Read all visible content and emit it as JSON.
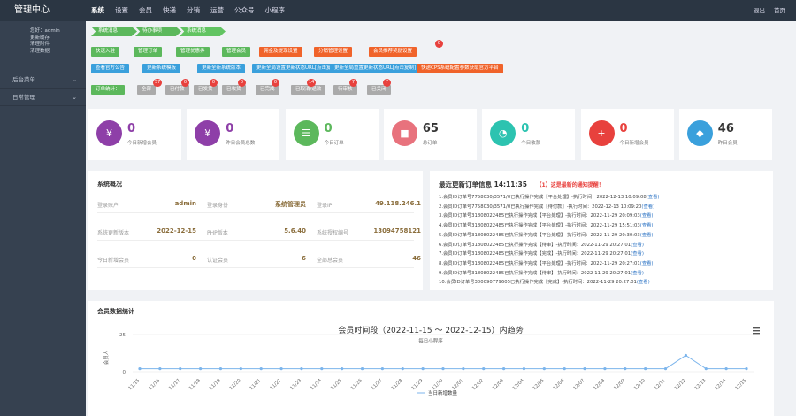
{
  "app": {
    "title": "管理中心"
  },
  "topnav": [
    "系统",
    "设置",
    "会员",
    "快递",
    "分销",
    "运营",
    "公众号",
    "小程序"
  ],
  "topright": [
    "退出",
    "首页"
  ],
  "user": {
    "greeting": "您好：admin",
    "links": [
      "更新缓存",
      "清理附件",
      "清理数据"
    ]
  },
  "sidebar": [
    {
      "label": "后台菜单"
    },
    {
      "label": "日常管理"
    }
  ],
  "toolbar": {
    "steps": [
      "系统消息",
      "待办事项",
      "系统消息"
    ],
    "row1": [
      {
        "label": "快速入驻",
        "color": "g"
      },
      {
        "label": "管理订单",
        "color": "g"
      },
      {
        "label": "管理优惠券",
        "color": "g"
      },
      {
        "label": "管理会员",
        "color": "g"
      },
      {
        "label": "佣金及提现设置",
        "color": "o"
      },
      {
        "label": "分销管理设置",
        "color": "o"
      },
      {
        "label": "会员推荐奖励设置",
        "color": "o",
        "badge": "0"
      }
    ],
    "row2": [
      {
        "label": "查看官方公告",
        "color": "b"
      },
      {
        "label": "更新系统模板",
        "color": "b"
      },
      {
        "label": "更新全新系统版本",
        "color": "b"
      },
      {
        "label": "更新全局设置更新状态URL[点击复制]",
        "color": "b"
      },
      {
        "label": "更新全局重置更新状态URL[点击复制]",
        "color": "b"
      },
      {
        "label": "快递CPS系统配置参数获取官方平台",
        "color": "o"
      }
    ],
    "orders_label": "订单统计：",
    "row3": [
      {
        "label": "全部",
        "badge": "57"
      },
      {
        "label": "已付款",
        "badge": "0"
      },
      {
        "label": "已发货",
        "badge": "0"
      },
      {
        "label": "已收货",
        "badge": "0"
      },
      {
        "label": "已完成",
        "badge": "0"
      },
      {
        "label": "已取消/退款",
        "badge": "14"
      },
      {
        "label": "待审核",
        "badge": "7"
      },
      {
        "label": "已关闭",
        "badge": "7"
      }
    ]
  },
  "stats": [
    {
      "value": "0",
      "label": "今日新增会员",
      "color": "#8e3fa8",
      "icon": "¥"
    },
    {
      "value": "0",
      "label": "昨日会员总数",
      "color": "#8e3fa8",
      "icon": "¥"
    },
    {
      "value": "0",
      "label": "今日订单",
      "color": "#5cb85c",
      "icon": "☰"
    },
    {
      "value": "65",
      "label": "总订单",
      "color": "#e8727d",
      "icon": "■"
    },
    {
      "value": "0",
      "label": "今日收款",
      "color": "#2cc3b0",
      "icon": "◔"
    },
    {
      "value": "0",
      "label": "今日新增会员",
      "color": "#e8413d",
      "icon": "+"
    },
    {
      "value": "46",
      "label": "昨日会员",
      "color": "#3aa0dc",
      "icon": "◆"
    }
  ],
  "sysinfo": {
    "title": "系统概况",
    "rows": [
      [
        {
          "k": "登录账户",
          "v": "admin"
        },
        {
          "k": "登录身份",
          "v": "系统管理员"
        },
        {
          "k": "登录IP",
          "v": "49.118.246.1"
        }
      ],
      [
        {
          "k": "系统更新版本",
          "v": "2022-12-15"
        },
        {
          "k": "PHP版本",
          "v": "5.6.40"
        },
        {
          "k": "系统授权编号",
          "v": "13094758121"
        }
      ],
      [
        {
          "k": "今日新增会员",
          "v": "0"
        },
        {
          "k": "认证会员",
          "v": "6"
        },
        {
          "k": "全部总会员",
          "v": "46"
        }
      ]
    ]
  },
  "log": {
    "title": "最近更新订单信息 14:11:35",
    "alert": "【1】这是最新的通知提醒！",
    "link": "(查看)",
    "lines": [
      {
        "text": "1.会员ID订单号7758030/3571/0已执行操作完成【平台处理】-执行时间：2022-12-13 10:09:08"
      },
      {
        "text": "2.会员ID订单号7758030/3571/0已执行操作完成【待付款】-执行时间：2022-12-13 10:09:20"
      },
      {
        "text": "3.会员ID订单号31808022485已执行操作完成【平台处理】-执行时间：2022-11-29 20:09:03"
      },
      {
        "text": "4.会员ID订单号31808022485已执行操作完成【平台处理】-执行时间：2022-11-29 15:51:03"
      },
      {
        "text": "5.会员ID订单号31808022485已执行操作完成【平台处理】-执行时间：2022-11-29 20:30:03"
      },
      {
        "text": "6.会员ID订单号31808022485已执行操作完成【待审】-执行时间：2022-11-29 20:27:01"
      },
      {
        "text": "7.会员ID订单号31808022485已执行操作完成【完成】-执行时间：2022-11-29 20:27:01"
      },
      {
        "text": "8.会员ID订单号31808022485已执行操作完成【平台处理】-执行时间：2022-11-29 20:27:01"
      },
      {
        "text": "9.会员ID订单号31808022485已执行操作完成【待审】-执行时间：2022-11-29 20:27:01"
      },
      {
        "text": "10.会员ID订单号300090779605已执行操作完成【完成】-执行时间：2022-11-29 20:27:01"
      }
    ]
  },
  "chart_data": {
    "type": "line",
    "title": "会员时间段（2022-11-15 ～ 2022-12-15）内趋势",
    "subtitle": "每日小程序",
    "ylabel": "会员人",
    "ylim": [
      0,
      25
    ],
    "yticks": [
      "25",
      "0"
    ],
    "categories": [
      "11/15",
      "11/16",
      "11/17",
      "11/18",
      "11/19",
      "11/20",
      "11/21",
      "11/22",
      "11/23",
      "11/24",
      "11/25",
      "11/26",
      "11/27",
      "11/28",
      "11/29",
      "11/30",
      "12/01",
      "12/02",
      "12/03",
      "12/04",
      "12/05",
      "12/06",
      "12/07",
      "12/08",
      "12/09",
      "12/10",
      "12/11",
      "12/12",
      "12/13",
      "12/14",
      "12/15"
    ],
    "series": [
      {
        "name": "当日新增数量",
        "values": [
          2,
          2,
          2,
          2,
          2,
          2,
          2,
          2,
          2,
          2,
          2,
          2,
          2,
          2,
          2,
          2,
          2,
          2,
          2,
          2,
          2,
          2,
          2,
          2,
          2,
          2,
          2,
          11,
          2,
          2,
          2
        ]
      }
    ],
    "menu_icon": "hamburger-menu-icon"
  },
  "chart_panel": {
    "title": "会员数据统计"
  }
}
